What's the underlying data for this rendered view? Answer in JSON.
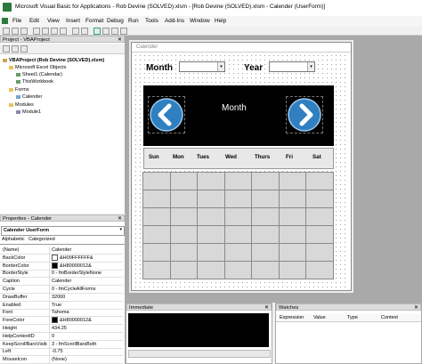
{
  "window": {
    "title": "Microsoft Visual Basic for Applications - Rob Devine (SOLVED).xlsm - [Rob Devine (SOLVED).xlsm - Calender (UserForm)]"
  },
  "menu": [
    "File",
    "Edit",
    "View",
    "Insert",
    "Format",
    "Debug",
    "Run",
    "Tools",
    "Add-Ins",
    "Window",
    "Help"
  ],
  "project_panel": {
    "title": "Project - VBAProject",
    "tree": [
      {
        "label": "VBAProject (Rob Devine (SOLVED).xlsm)",
        "bold": true
      },
      {
        "label": "Microsoft Excel Objects"
      },
      {
        "label": "Sheet1 (Calendar)"
      },
      {
        "label": "ThisWorkbook"
      },
      {
        "label": "Forms"
      },
      {
        "label": "Calender"
      },
      {
        "label": "Modules"
      },
      {
        "label": "Module1"
      }
    ]
  },
  "properties_panel": {
    "title": "Properties - Calender",
    "object": "Calender UserForm",
    "tabs": [
      "Alphabetic",
      "Categorized"
    ],
    "rows": [
      {
        "name": "(Name)",
        "value": "Calender"
      },
      {
        "name": "BackColor",
        "value": "&H00FFFFFF&",
        "swatch": "#ffffff"
      },
      {
        "name": "BorderColor",
        "value": "&H80000012&",
        "swatch": "#000000"
      },
      {
        "name": "BorderStyle",
        "value": "0 - fmBorderStyleNone"
      },
      {
        "name": "Caption",
        "value": "Calender"
      },
      {
        "name": "Cycle",
        "value": "0 - fmCycleAllForms"
      },
      {
        "name": "DrawBuffer",
        "value": "32000"
      },
      {
        "name": "Enabled",
        "value": "True"
      },
      {
        "name": "Font",
        "value": "Tahoma"
      },
      {
        "name": "ForeColor",
        "value": "&H80000012&",
        "swatch": "#000000"
      },
      {
        "name": "Height",
        "value": "434.25"
      },
      {
        "name": "HelpContextID",
        "value": "0"
      },
      {
        "name": "KeepScrollBarsVisible",
        "value": "3 - fmScrollBarsBoth"
      },
      {
        "name": "Left",
        "value": "-0.75"
      },
      {
        "name": "MouseIcon",
        "value": "(None)"
      }
    ]
  },
  "form": {
    "caption": "Calender",
    "month_label": "Month",
    "year_label": "Year",
    "header_month": "Month",
    "prev_icon": "chevron-left-icon",
    "next_icon": "chevron-right-icon",
    "days": [
      "Sun",
      "Mon",
      "Tues",
      "Wed",
      "Thurs",
      "Fri",
      "Sat"
    ],
    "grid_rows": 6,
    "grid_cols": 7
  },
  "immediate": {
    "title": "Immediate"
  },
  "watches": {
    "title": "Watches",
    "columns": [
      "Expression",
      "Value",
      "Type",
      "Context"
    ]
  }
}
